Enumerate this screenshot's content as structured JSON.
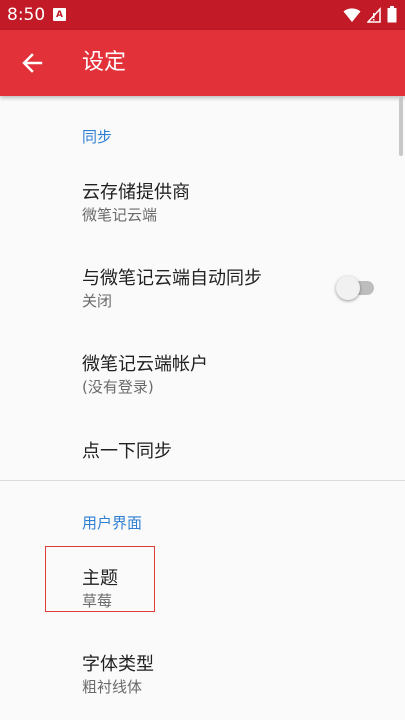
{
  "status_bar": {
    "time": "8:50",
    "notification_glyph": "A",
    "icons": [
      "wifi-icon",
      "signal-icon",
      "battery-icon"
    ]
  },
  "app_bar": {
    "title": "设定",
    "back_icon": "arrow-back-icon"
  },
  "sections": {
    "sync": {
      "header": "同步",
      "items": [
        {
          "title": "云存储提供商",
          "summary": "微笔记云端"
        },
        {
          "title": "与微笔记云端自动同步",
          "summary": "关闭",
          "toggle": false
        },
        {
          "title": "微笔记云端帐户",
          "summary": "(没有登录)"
        },
        {
          "title": "点一下同步"
        }
      ]
    },
    "ui": {
      "header": "用户界面",
      "items": [
        {
          "title": "主题",
          "summary": "草莓"
        },
        {
          "title": "字体类型",
          "summary": "粗衬线体"
        }
      ]
    }
  },
  "colors": {
    "status_bar": "#c21a26",
    "app_bar": "#e3313a",
    "category": "#2f7fd3",
    "highlight": "#e23b3b"
  }
}
